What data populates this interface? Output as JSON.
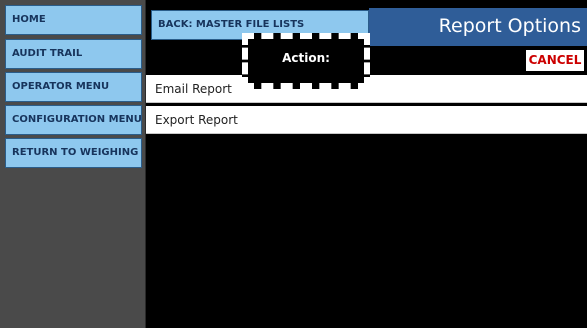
{
  "sidebar": {
    "items": [
      {
        "label": "HOME"
      },
      {
        "label": "AUDIT TRAIL"
      },
      {
        "label": "OPERATOR MENU"
      },
      {
        "label": "CONFIGURATION MENU"
      },
      {
        "label": "RETURN TO WEIGHING"
      }
    ]
  },
  "header": {
    "back_label": "BACK: MASTER FILE LISTS",
    "title": "Report Options",
    "cancel_label": "CANCEL"
  },
  "list": {
    "items": [
      {
        "label": "Email Report"
      },
      {
        "label": "Export Report"
      }
    ]
  },
  "popup": {
    "label": "Action:"
  },
  "colors": {
    "sidebar_button": "#8ec8ee",
    "title_bar": "#2f5d98",
    "cancel_text": "#cc0000",
    "sidebar_bg": "#4a4a4a"
  }
}
